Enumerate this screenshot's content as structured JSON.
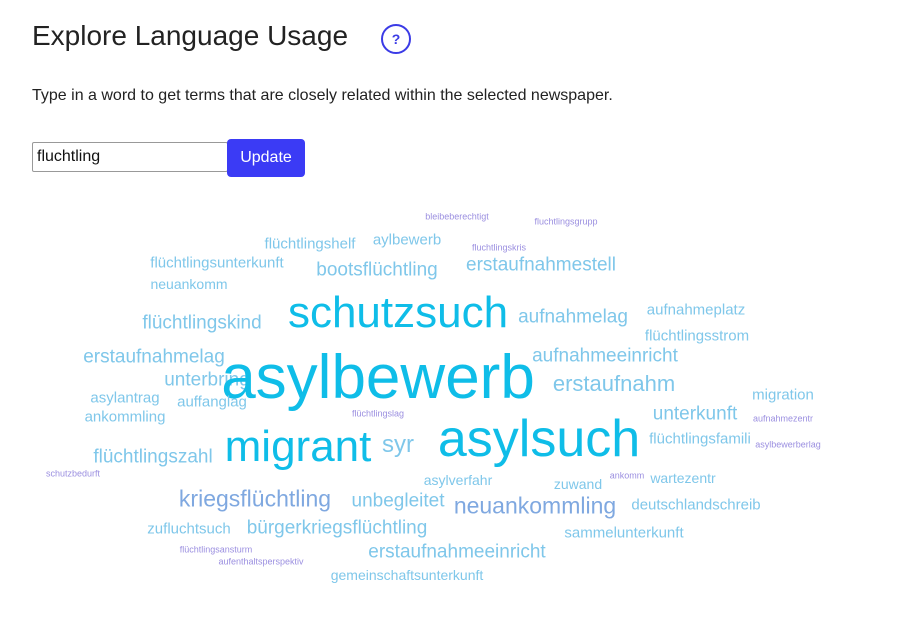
{
  "header": {
    "title": "Explore Language Usage",
    "help_icon": "question-mark-icon",
    "help_glyph": "?"
  },
  "intro_text": "Type in a word to get terms that are closely related within the selected newspaper.",
  "search": {
    "value": "fluchtling",
    "update_label": "Update"
  },
  "word_cloud": {
    "words": [
      {
        "text": "bleibeberechtigt",
        "color": "#9b8fe0",
        "size": 9
      },
      {
        "text": "fluchtlingsgrupp",
        "color": "#9b8fe0",
        "size": 9
      },
      {
        "text": "flüchtlingshelf",
        "color": "#7fc7ea",
        "size": 15
      },
      {
        "text": "aylbewerb",
        "color": "#7fc7ea",
        "size": 15
      },
      {
        "text": "fluchtlingskris",
        "color": "#9b8fe0",
        "size": 9
      },
      {
        "text": "flüchtlingsunterkunft",
        "color": "#7fc7ea",
        "size": 15
      },
      {
        "text": "bootsflüchtling",
        "color": "#7fc7ea",
        "size": 19
      },
      {
        "text": "erstaufnahmestell",
        "color": "#7fc7ea",
        "size": 19
      },
      {
        "text": "neuankomm",
        "color": "#7fc7ea",
        "size": 14
      },
      {
        "text": "schutzsuch",
        "color": "#0fbde8",
        "size": 44
      },
      {
        "text": "aufnahmeplatz",
        "color": "#7fc7ea",
        "size": 15
      },
      {
        "text": "flüchtlingskind",
        "color": "#7fc7ea",
        "size": 19
      },
      {
        "text": "aufnahmelag",
        "color": "#7fc7ea",
        "size": 19
      },
      {
        "text": "flüchtlingsstrom",
        "color": "#7fc7ea",
        "size": 15
      },
      {
        "text": "erstaufnahmelag",
        "color": "#7fc7ea",
        "size": 19
      },
      {
        "text": "aufnahmeeinricht",
        "color": "#7fc7ea",
        "size": 19
      },
      {
        "text": "unterbring",
        "color": "#7fc7ea",
        "size": 19
      },
      {
        "text": "asylbewerb",
        "color": "#0fbde8",
        "size": 62
      },
      {
        "text": "erstaufnahm",
        "color": "#7fc7ea",
        "size": 22
      },
      {
        "text": "asylantrag",
        "color": "#7fc7ea",
        "size": 15
      },
      {
        "text": "auffanglag",
        "color": "#7fc7ea",
        "size": 15
      },
      {
        "text": "migration",
        "color": "#7fc7ea",
        "size": 15
      },
      {
        "text": "ankommling",
        "color": "#7fc7ea",
        "size": 15
      },
      {
        "text": "flüchtlingslag",
        "color": "#9b8fe0",
        "size": 9
      },
      {
        "text": "unterkunft",
        "color": "#7fc7ea",
        "size": 19
      },
      {
        "text": "aufnahmezentr",
        "color": "#9b8fe0",
        "size": 9
      },
      {
        "text": "migrant",
        "color": "#0fbde8",
        "size": 44
      },
      {
        "text": "asylsuch",
        "color": "#0fbde8",
        "size": 52
      },
      {
        "text": "syr",
        "color": "#7fc7ea",
        "size": 24
      },
      {
        "text": "flüchtlingsfamili",
        "color": "#7fc7ea",
        "size": 15
      },
      {
        "text": "asylbewerberlag",
        "color": "#9b8fe0",
        "size": 9
      },
      {
        "text": "flüchtlingszahl",
        "color": "#7fc7ea",
        "size": 19
      },
      {
        "text": "schutzbedurft",
        "color": "#9b8fe0",
        "size": 9
      },
      {
        "text": "asylverfahr",
        "color": "#7fc7ea",
        "size": 14
      },
      {
        "text": "ankomm",
        "color": "#9b8fe0",
        "size": 9
      },
      {
        "text": "zuwand",
        "color": "#7fc7ea",
        "size": 14
      },
      {
        "text": "wartezentr",
        "color": "#7fc7ea",
        "size": 14
      },
      {
        "text": "kriegsflüchtling",
        "color": "#7fa8e0",
        "size": 23
      },
      {
        "text": "unbegleitet",
        "color": "#7fc7ea",
        "size": 19
      },
      {
        "text": "neuankommling",
        "color": "#7fa8e0",
        "size": 23
      },
      {
        "text": "deutschlandschreib",
        "color": "#7fc7ea",
        "size": 15
      },
      {
        "text": "zufluchtsuch",
        "color": "#7fc7ea",
        "size": 15
      },
      {
        "text": "bürgerkriegsflüchtling",
        "color": "#7fc7ea",
        "size": 19
      },
      {
        "text": "sammelunterkunft",
        "color": "#7fc7ea",
        "size": 15
      },
      {
        "text": "flüchtlingsansturm",
        "color": "#9b8fe0",
        "size": 9
      },
      {
        "text": "aufenthaltsperspektiv",
        "color": "#9b8fe0",
        "size": 9
      },
      {
        "text": "erstaufnahmeeinricht",
        "color": "#7fc7ea",
        "size": 19
      },
      {
        "text": "gemeinschaftsunterkunft",
        "color": "#7fc7ea",
        "size": 14
      }
    ]
  }
}
